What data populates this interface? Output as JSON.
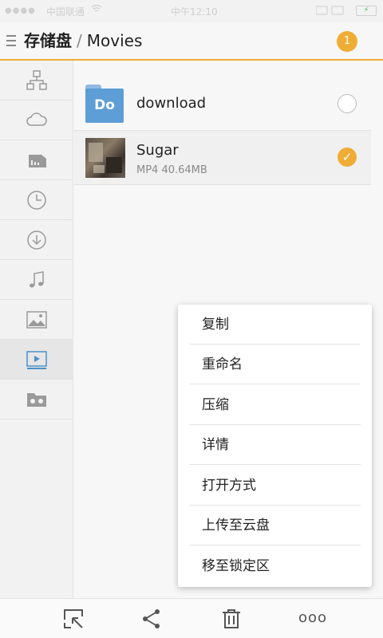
{
  "status_bar": {
    "carrier": "中国联通",
    "time": "中午12:10",
    "battery": "97"
  },
  "header": {
    "root": "存储盘",
    "separator": "/",
    "current": "Movies",
    "badge_count": "1",
    "accent_color": "#efad35"
  },
  "sidebar": {
    "items": [
      {
        "icon": "network-tree-icon",
        "active": false
      },
      {
        "icon": "cloud-icon",
        "active": false
      },
      {
        "icon": "sd-card-icon",
        "active": false
      },
      {
        "icon": "clock-icon",
        "active": false
      },
      {
        "icon": "download-icon",
        "active": false
      },
      {
        "icon": "music-note-icon",
        "active": false
      },
      {
        "icon": "image-icon",
        "active": false
      },
      {
        "icon": "video-icon",
        "active": true
      },
      {
        "icon": "vr-glasses-icon",
        "active": false
      }
    ]
  },
  "files": [
    {
      "name": "download",
      "icon": "folder-icon",
      "icon_text": "Do",
      "meta": "",
      "selected": false
    },
    {
      "name": "Sugar",
      "icon": "video-thumbnail",
      "meta": "MP4 40.64MB",
      "selected": true
    }
  ],
  "context_menu": {
    "items": [
      "复制",
      "重命名",
      "压缩",
      "详情",
      "打开方式",
      "上传至云盘",
      "移至锁定区"
    ]
  },
  "toolbar": {
    "buttons": [
      "select-icon",
      "share-icon",
      "trash-icon",
      "more-icon"
    ],
    "more_label": "ooo"
  }
}
